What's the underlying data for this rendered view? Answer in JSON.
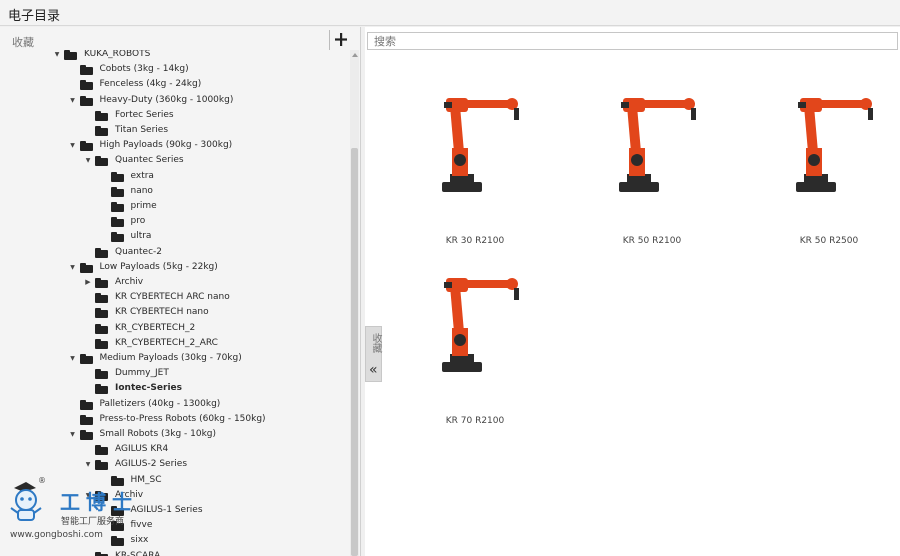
{
  "window": {
    "title": "电子目录"
  },
  "favorites": {
    "label": "收藏",
    "add_label": "+"
  },
  "tree": [
    {
      "label": "KUKA_ROBOTS",
      "expanded": true,
      "depth": 0
    },
    {
      "label": "Cobots (3kg - 14kg)",
      "expanded": false,
      "depth": 1
    },
    {
      "label": "Fenceless (4kg - 24kg)",
      "expanded": false,
      "depth": 1
    },
    {
      "label": "Heavy-Duty (360kg - 1000kg)",
      "expanded": true,
      "depth": 1
    },
    {
      "label": "Fortec Series",
      "expanded": false,
      "depth": 2
    },
    {
      "label": "Titan Series",
      "expanded": false,
      "depth": 2
    },
    {
      "label": "High Payloads (90kg - 300kg)",
      "expanded": true,
      "depth": 1
    },
    {
      "label": "Quantec Series",
      "expanded": true,
      "depth": 2
    },
    {
      "label": "extra",
      "expanded": false,
      "depth": 3
    },
    {
      "label": "nano",
      "expanded": false,
      "depth": 3
    },
    {
      "label": "prime",
      "expanded": false,
      "depth": 3
    },
    {
      "label": "pro",
      "expanded": false,
      "depth": 3
    },
    {
      "label": "ultra",
      "expanded": false,
      "depth": 3
    },
    {
      "label": "Quantec-2",
      "expanded": false,
      "depth": 2
    },
    {
      "label": "Low Payloads (5kg - 22kg)",
      "expanded": true,
      "depth": 1
    },
    {
      "label": "Archiv",
      "expanded": false,
      "depth": 2,
      "collapsed_arrow": true
    },
    {
      "label": "KR CYBERTECH ARC nano",
      "expanded": false,
      "depth": 2
    },
    {
      "label": "KR CYBERTECH nano",
      "expanded": false,
      "depth": 2
    },
    {
      "label": "KR_CYBERTECH_2",
      "expanded": false,
      "depth": 2
    },
    {
      "label": "KR_CYBERTECH_2_ARC",
      "expanded": false,
      "depth": 2
    },
    {
      "label": "Medium Payloads (30kg - 70kg)",
      "expanded": true,
      "depth": 1
    },
    {
      "label": "Dummy_JET",
      "expanded": false,
      "depth": 2
    },
    {
      "label": "Iontec-Series",
      "expanded": false,
      "depth": 2,
      "selected": true
    },
    {
      "label": "Palletizers (40kg - 1300kg)",
      "expanded": false,
      "depth": 1
    },
    {
      "label": "Press-to-Press Robots (60kg - 150kg)",
      "expanded": false,
      "depth": 1
    },
    {
      "label": "Small Robots (3kg - 10kg)",
      "expanded": true,
      "depth": 1
    },
    {
      "label": "AGILUS KR4",
      "expanded": false,
      "depth": 2
    },
    {
      "label": "AGILUS-2 Series",
      "expanded": true,
      "depth": 2
    },
    {
      "label": "HM_SC",
      "expanded": false,
      "depth": 3
    },
    {
      "label": "Archiv",
      "expanded": true,
      "depth": 2
    },
    {
      "label": "AGILUS-1 Series",
      "expanded": false,
      "depth": 3
    },
    {
      "label": "fivve",
      "expanded": false,
      "depth": 3
    },
    {
      "label": "sixx",
      "expanded": false,
      "depth": 3
    },
    {
      "label": "KR-SCARA",
      "expanded": false,
      "depth": 2
    }
  ],
  "collapse_panel": {
    "label": "收藏",
    "icon": "double-chevron-left-icon"
  },
  "search": {
    "placeholder": "搜索",
    "value": ""
  },
  "products": [
    {
      "name": "KR 30 R2100"
    },
    {
      "name": "KR 50 R2100"
    },
    {
      "name": "KR 50 R2500"
    },
    {
      "name": "KR 70 R2100"
    }
  ],
  "watermark": {
    "brand": "工博士",
    "subtitle": "智能工厂服务商",
    "url": "www.gongboshi.com",
    "reg": "®"
  },
  "colors": {
    "robot_orange": "#e2461b",
    "robot_dark": "#2b2b2b",
    "brand_blue": "#2e79c4"
  }
}
